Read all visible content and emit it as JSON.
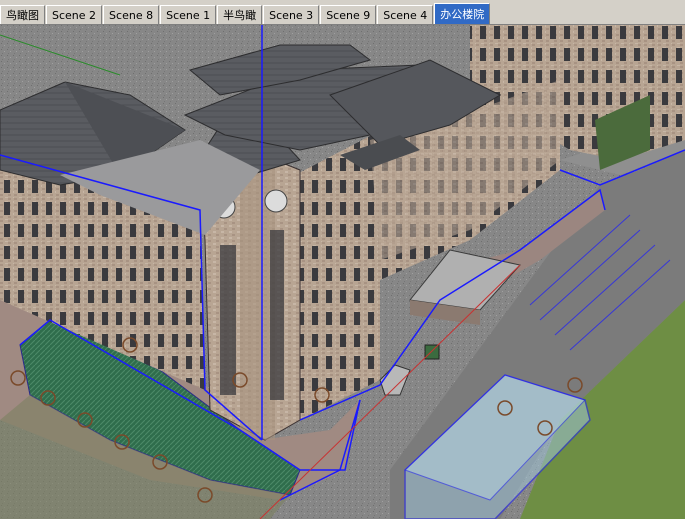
{
  "scene_tabs": [
    {
      "label": "鸟瞰图",
      "active": false
    },
    {
      "label": "Scene 2",
      "active": false
    },
    {
      "label": "Scene 8",
      "active": false
    },
    {
      "label": "Scene 1",
      "active": false
    },
    {
      "label": "半鸟瞰",
      "active": false
    },
    {
      "label": "Scene 3",
      "active": false
    },
    {
      "label": "Scene 9",
      "active": false
    },
    {
      "label": "Scene 4",
      "active": false
    },
    {
      "label": "办公楼院",
      "active": true
    }
  ],
  "colors": {
    "active_tab": "#316ac5",
    "selection_blue": "#1a1aff",
    "roof": "#5b5d62",
    "wall": "#b9a695",
    "lawn": "#6f8f45",
    "hedge": "#2e6b4a",
    "pool": "#9fc3d6"
  }
}
